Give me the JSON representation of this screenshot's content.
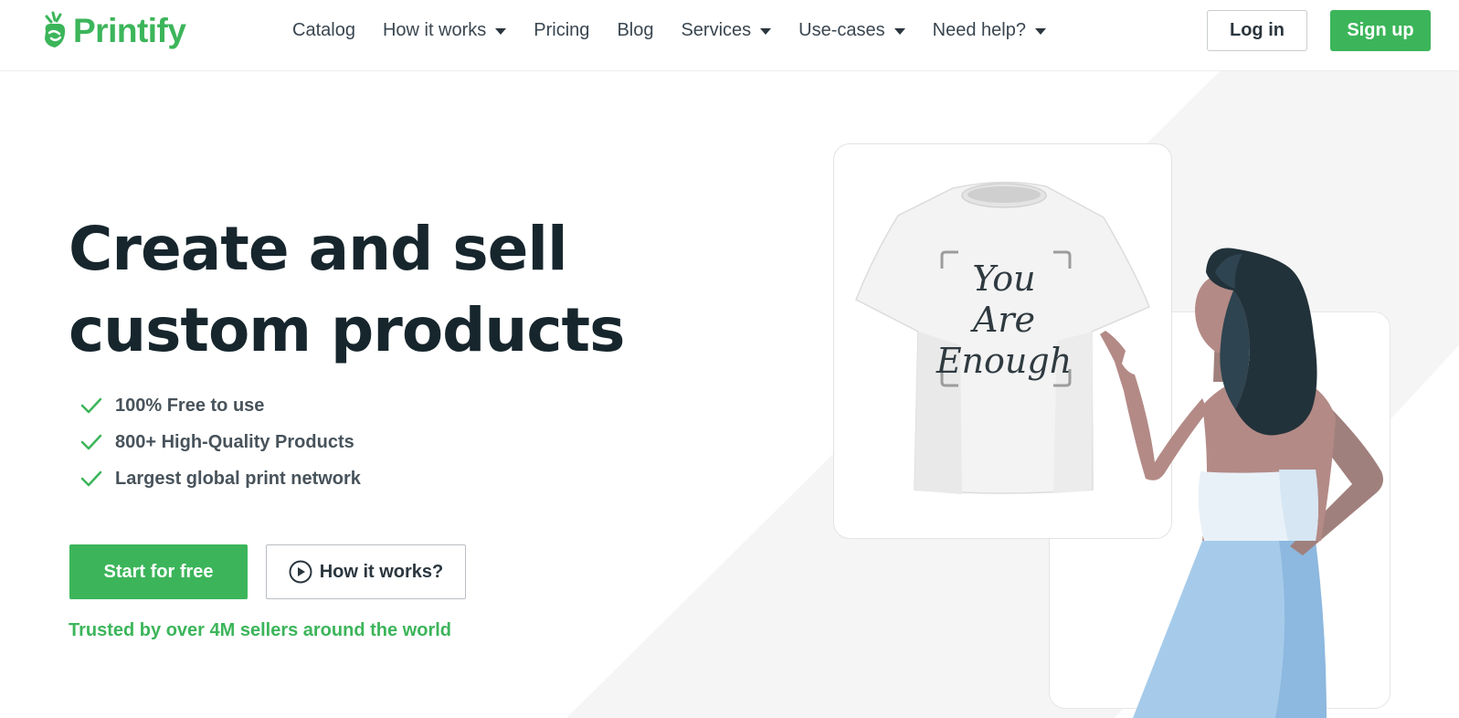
{
  "brand": {
    "name": "Printify",
    "color": "#3cb55a"
  },
  "nav": {
    "items": [
      {
        "label": "Catalog",
        "dropdown": false
      },
      {
        "label": "How it works",
        "dropdown": true
      },
      {
        "label": "Pricing",
        "dropdown": false
      },
      {
        "label": "Blog",
        "dropdown": false
      },
      {
        "label": "Services",
        "dropdown": true
      },
      {
        "label": "Use-cases",
        "dropdown": true
      },
      {
        "label": "Need help?",
        "dropdown": true
      }
    ],
    "login_label": "Log in",
    "signup_label": "Sign up"
  },
  "hero": {
    "title_line1": "Create and sell",
    "title_line2": "custom products",
    "features": [
      "100% Free to use",
      "800+ High-Quality Products",
      "Largest global print network"
    ],
    "start_label": "Start for free",
    "how_label": "How it works?",
    "trusted": "Trusted by over 4M sellers around the world"
  },
  "tshirt_design": {
    "line1": "You",
    "line2": "Are",
    "line3": "Enough"
  },
  "icons": [
    "printify-logo-icon",
    "chevron-down-icon",
    "check-icon",
    "play-circle-icon"
  ]
}
